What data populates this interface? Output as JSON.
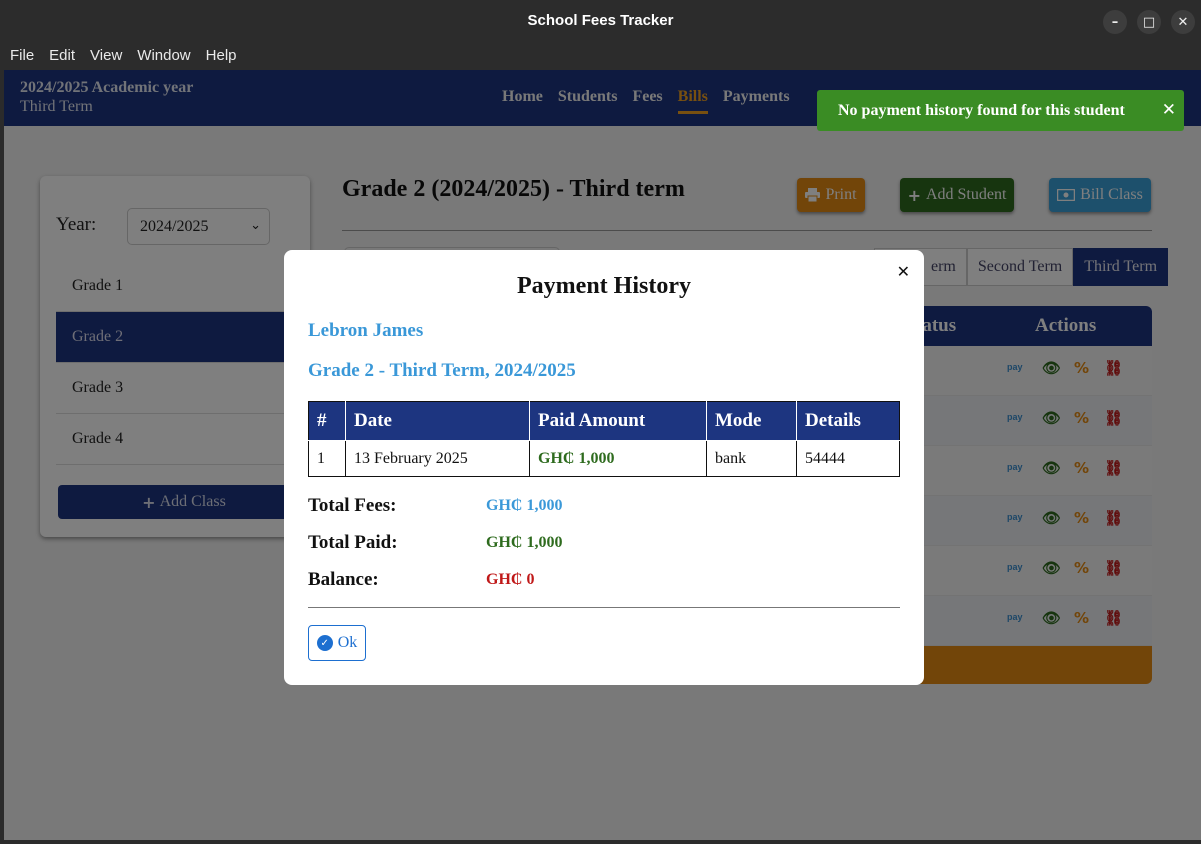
{
  "window": {
    "title": "School Fees Tracker",
    "minimize_glyph": "–",
    "maximize_glyph": "□",
    "close_glyph": "✕"
  },
  "menu": [
    "File",
    "Edit",
    "View",
    "Window",
    "Help"
  ],
  "navbar": {
    "academic_year": "2024/2025 Academic year",
    "term": "Third Term",
    "links": [
      "Home",
      "Students",
      "Fees",
      "Bills",
      "Payments"
    ],
    "active_link": "Bills"
  },
  "sidebar": {
    "year_label": "Year:",
    "year_value": "2024/2025",
    "grades": [
      "Grade 1",
      "Grade 2",
      "Grade 3",
      "Grade 4"
    ],
    "active_grade": "Grade 2",
    "add_class": "Add Class"
  },
  "main": {
    "title": "Grade 2 (2024/2025) - Third term",
    "print": "Print",
    "add_student": "Add Student",
    "bill_class": "Bill Class",
    "term_tabs": [
      "erm",
      "Second Term",
      "Third Term"
    ],
    "active_tab": "Third Term",
    "headers": {
      "status": "tatus",
      "actions": "Actions"
    },
    "row_count": 6,
    "pay_icon_text": "pay"
  },
  "toast": {
    "message": "No payment history found for this student",
    "close": "✕"
  },
  "modal": {
    "title": "Payment History",
    "student": "Lebron James",
    "class_term": "Grade 2 - Third Term, 2024/2025",
    "columns": [
      "#",
      "Date",
      "Paid Amount",
      "Mode",
      "Details"
    ],
    "rows": [
      {
        "num": "1",
        "date": "13 February 2025",
        "amount": "GH₵ 1,000",
        "mode": "bank",
        "details": "54444"
      }
    ],
    "total_fees_label": "Total Fees:",
    "total_fees": "GH₵ 1,000",
    "total_paid_label": "Total Paid:",
    "total_paid": "GH₵ 1,000",
    "balance_label": "Balance:",
    "balance": "GH₵ 0",
    "ok": "Ok",
    "close": "✕"
  },
  "colors": {
    "primary": "#1d3580",
    "accent": "#e58a12",
    "success": "#2e6b1e",
    "info": "#3a98d8",
    "danger": "#c01818"
  }
}
